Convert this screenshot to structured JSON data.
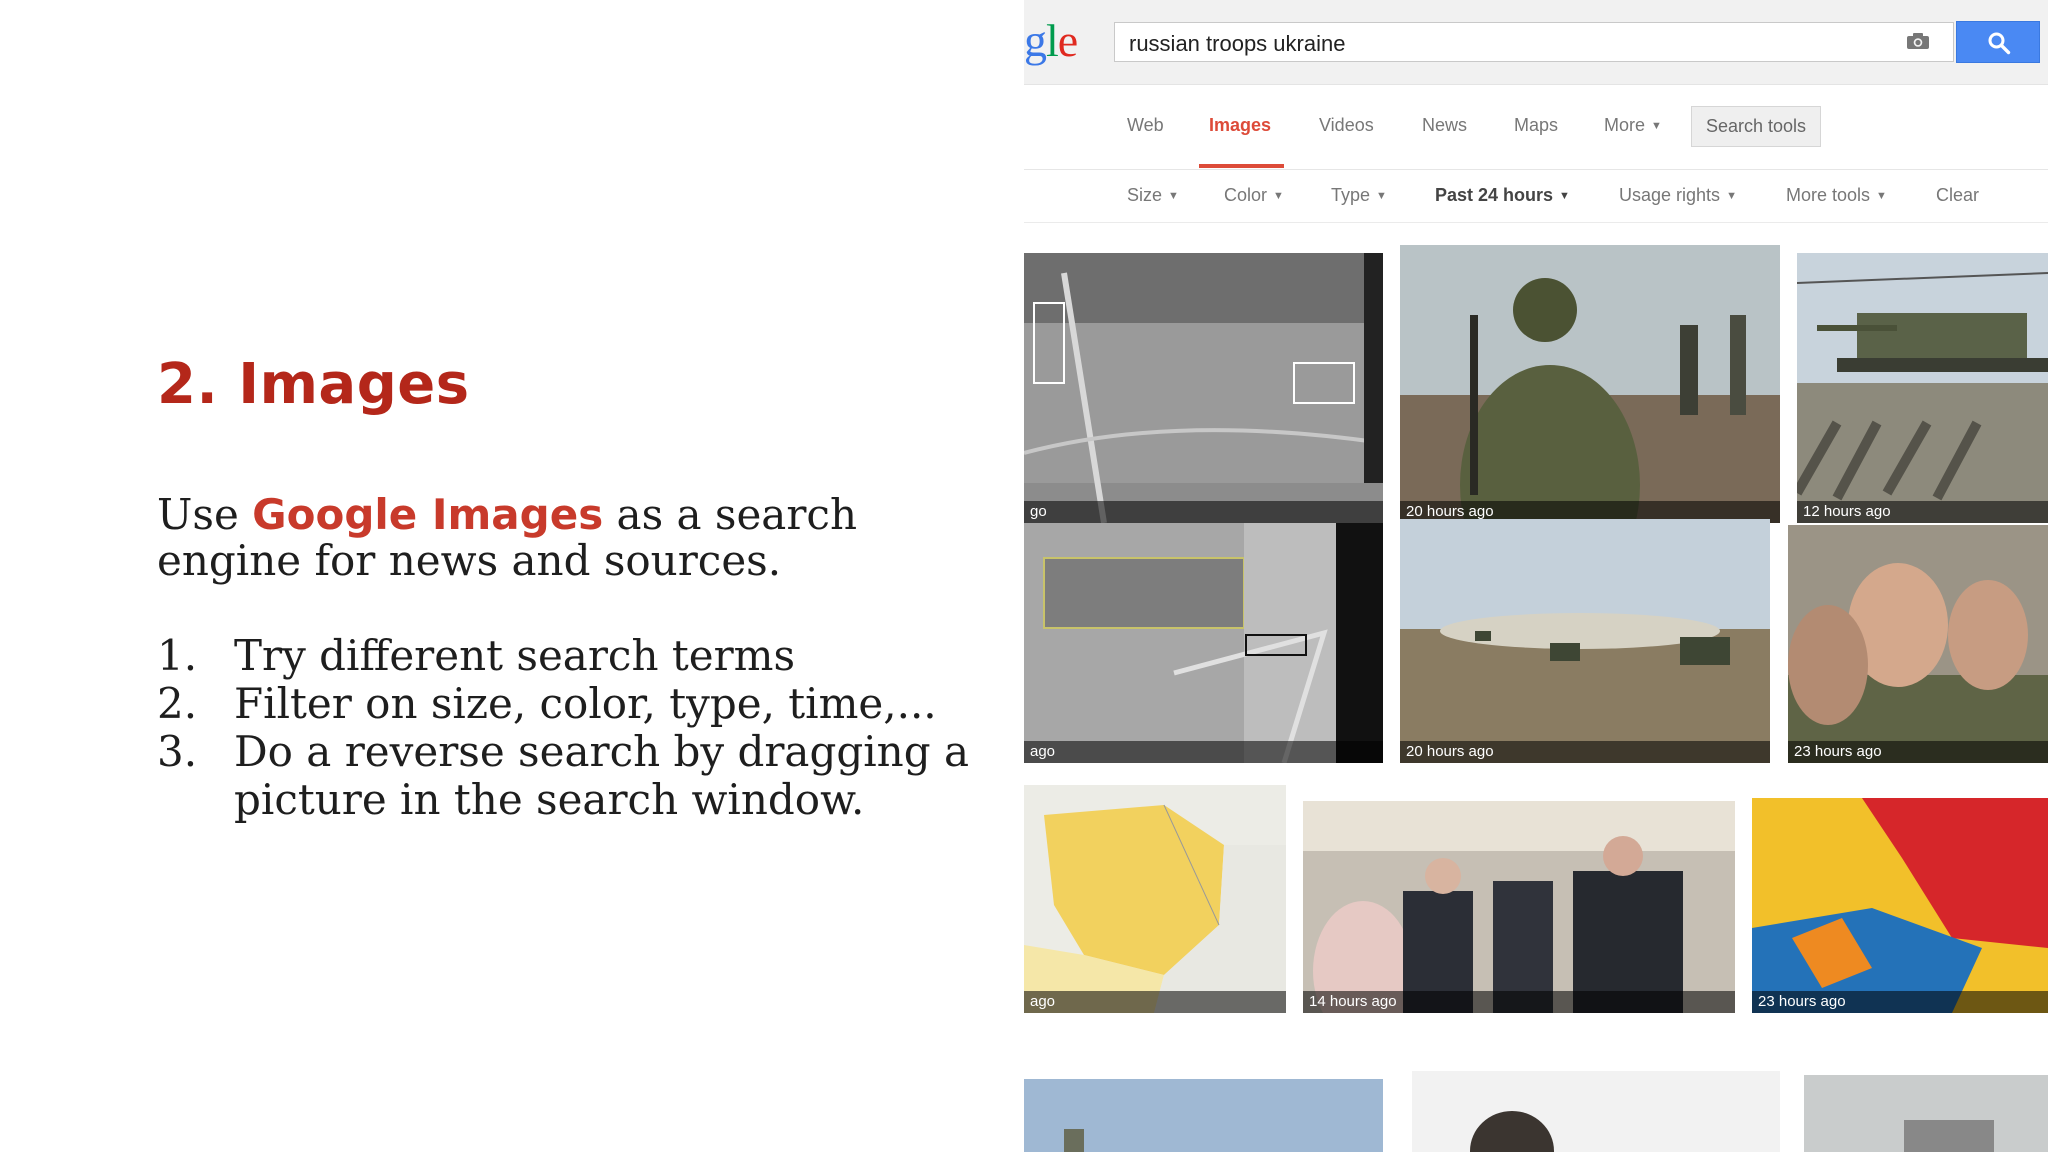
{
  "slide": {
    "title": "2. Images",
    "intro_prefix": "Use ",
    "intro_highlight": "Google Images",
    "intro_suffix": " as a search engine for news and sources.",
    "steps": [
      {
        "num": "1.",
        "text": "Try different search terms"
      },
      {
        "num": "2.",
        "text": "Filter on size, color, type, time,..."
      },
      {
        "num": "3.",
        "text": "Do a reverse search by dragging a picture in the search window."
      }
    ]
  },
  "browser": {
    "logo_partial": "gle",
    "search_query": "russian troops ukraine",
    "camera_icon": "camera-icon",
    "search_icon": "magnifier-icon",
    "accent_color": "#dd4b39",
    "search_button_color": "#4a89f3",
    "tabs": [
      {
        "label": "Web"
      },
      {
        "label": "Images",
        "active": true
      },
      {
        "label": "Videos"
      },
      {
        "label": "News"
      },
      {
        "label": "Maps"
      },
      {
        "label": "More"
      }
    ],
    "search_tools_label": "Search tools",
    "tools": [
      {
        "label": "Size"
      },
      {
        "label": "Color"
      },
      {
        "label": "Type"
      },
      {
        "label": "Past 24 hours",
        "active": true
      },
      {
        "label": "Usage rights"
      },
      {
        "label": "More tools"
      },
      {
        "label": "Clear"
      }
    ],
    "results": [
      {
        "time": "go"
      },
      {
        "time": "20 hours ago"
      },
      {
        "time": "12 hours ago"
      },
      {
        "time": "ago"
      },
      {
        "time": "20 hours ago"
      },
      {
        "time": "23 hours ago"
      },
      {
        "time": "ago"
      },
      {
        "time": "14 hours ago"
      },
      {
        "time": "23 hours ago"
      }
    ]
  }
}
